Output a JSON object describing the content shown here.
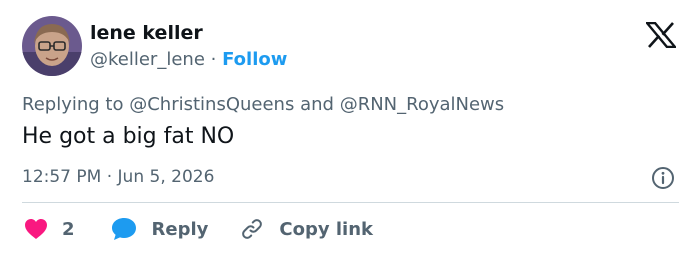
{
  "author": {
    "display_name": "lene keller",
    "handle": "@keller_lene",
    "separator": "·",
    "follow_label": "Follow"
  },
  "reply_context": {
    "prefix": "Replying to",
    "mention_1": "@ChristinsQueens",
    "joiner": "and",
    "mention_2": "@RNN_RoyalNews"
  },
  "tweet": {
    "text": "He got a big fat NO",
    "time": "12:57 PM",
    "separator": "·",
    "date": "Jun 5, 2026"
  },
  "actions": {
    "like_count": "2",
    "reply_label": "Reply",
    "copy_label": "Copy link"
  },
  "colors": {
    "like": "#f91880",
    "reply": "#1d9bf0",
    "link_blue": "#1d9bf0",
    "secondary_text": "#536471"
  },
  "icons": {
    "logo": "x-logo-icon",
    "info": "info-icon",
    "like": "heart-icon",
    "reply": "speech-bubble-icon",
    "copy": "link-icon"
  }
}
